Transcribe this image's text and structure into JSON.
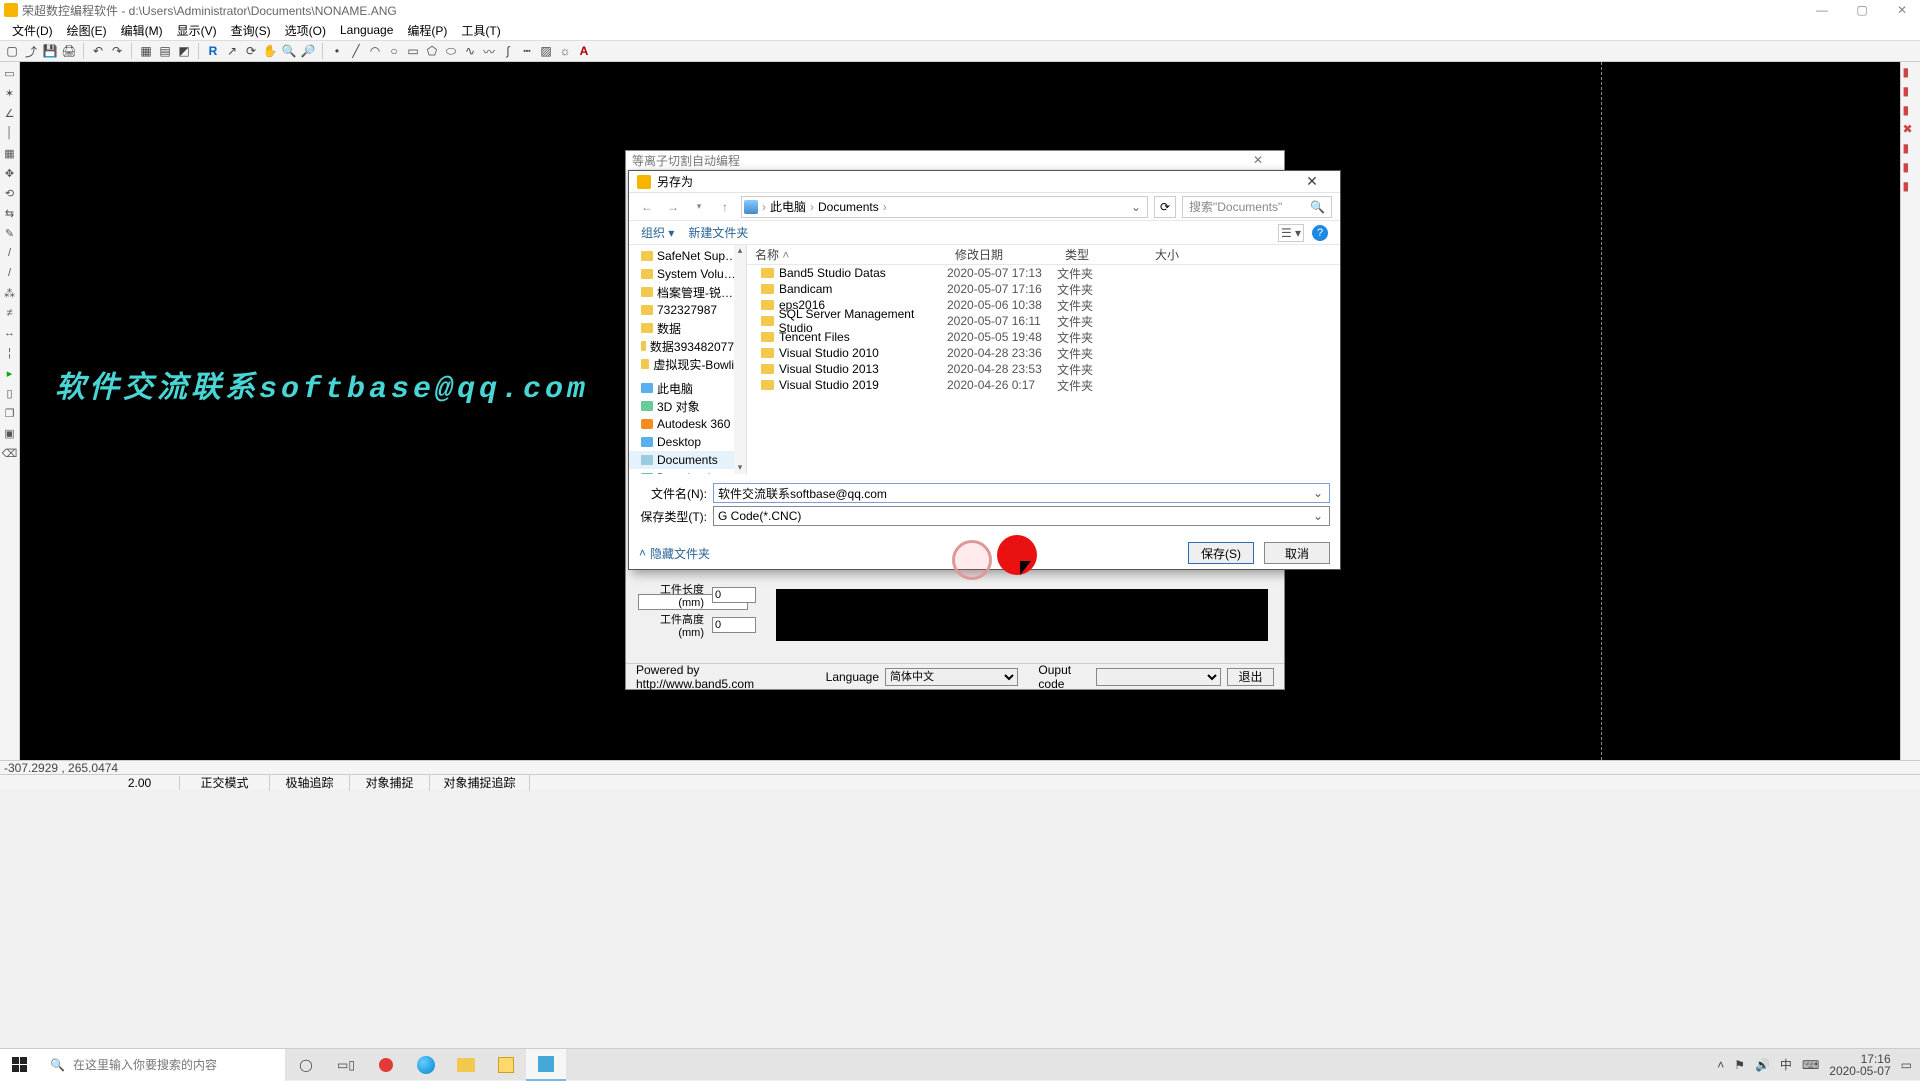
{
  "titlebar": {
    "title": "荣超数控编程软件 - d:\\Users\\Administrator\\Documents\\NONAME.ANG"
  },
  "menus": [
    "文件(D)",
    "绘图(E)",
    "编辑(M)",
    "显示(V)",
    "查询(S)",
    "选项(O)",
    "Language",
    "编程(P)",
    "工具(T)"
  ],
  "canvas_text": "软件交流联系softbase@qq.com",
  "coord": "-307.2929 , 265.0474",
  "status": {
    "zoom": "2.00",
    "mode": "正交模式",
    "polar": "极轴追踪",
    "osnap": "对象捕捉",
    "otrack": "对象捕捉追踪"
  },
  "innerdlg": {
    "title": "等离子切割自动编程",
    "len_label": "工件长度(mm)",
    "len_val": "0",
    "hgt_label": "工件高度(mm)",
    "hgt_val": "0",
    "powered": "Powered by http://www.band5.com",
    "lang_label": "Language",
    "lang_val": "简体中文",
    "out_label": "Ouput code",
    "out_val": "",
    "exit": "退出"
  },
  "savedlg": {
    "title": "另存为",
    "bc1": "此电脑",
    "bc2": "Documents",
    "search_ph": "搜索\"Documents\"",
    "organize": "组织 ▾",
    "newfolder": "新建文件夹",
    "cols": {
      "name": "名称",
      "date": "修改日期",
      "type": "类型",
      "size": "大小"
    },
    "tree": [
      "SafeNet Sup…",
      "System Volu…",
      "档案管理-锐…",
      "732327987",
      "数据",
      "数据393482077…",
      "虚拟现实-Bowli…"
    ],
    "tree_pc": "此电脑",
    "tree_3d": "3D 对象",
    "tree_ad": "Autodesk 360",
    "tree_dk": "Desktop",
    "tree_doc": "Documents",
    "tree_dl": "Downloads",
    "files": [
      {
        "n": "Band5 Studio Datas",
        "d": "2020-05-07 17:13",
        "t": "文件夹"
      },
      {
        "n": "Bandicam",
        "d": "2020-05-07 17:16",
        "t": "文件夹"
      },
      {
        "n": "eps2016",
        "d": "2020-05-06 10:38",
        "t": "文件夹"
      },
      {
        "n": "SQL Server Management Studio",
        "d": "2020-05-07 16:11",
        "t": "文件夹"
      },
      {
        "n": "Tencent Files",
        "d": "2020-05-05 19:48",
        "t": "文件夹"
      },
      {
        "n": "Visual Studio 2010",
        "d": "2020-04-28 23:36",
        "t": "文件夹"
      },
      {
        "n": "Visual Studio 2013",
        "d": "2020-04-28 23:53",
        "t": "文件夹"
      },
      {
        "n": "Visual Studio 2019",
        "d": "2020-04-26 0:17",
        "t": "文件夹"
      }
    ],
    "fname_label": "文件名(N):",
    "fname_val": "软件交流联系softbase@qq.com",
    "ftype_label": "保存类型(T):",
    "ftype_val": "G Code(*.CNC)",
    "hide": "隐藏文件夹",
    "save": "保存(S)",
    "cancel": "取消"
  },
  "taskbar": {
    "search_ph": "在这里输入你要搜索的内容",
    "time": "17:16",
    "date": "2020-05-07",
    "ime": "中"
  }
}
